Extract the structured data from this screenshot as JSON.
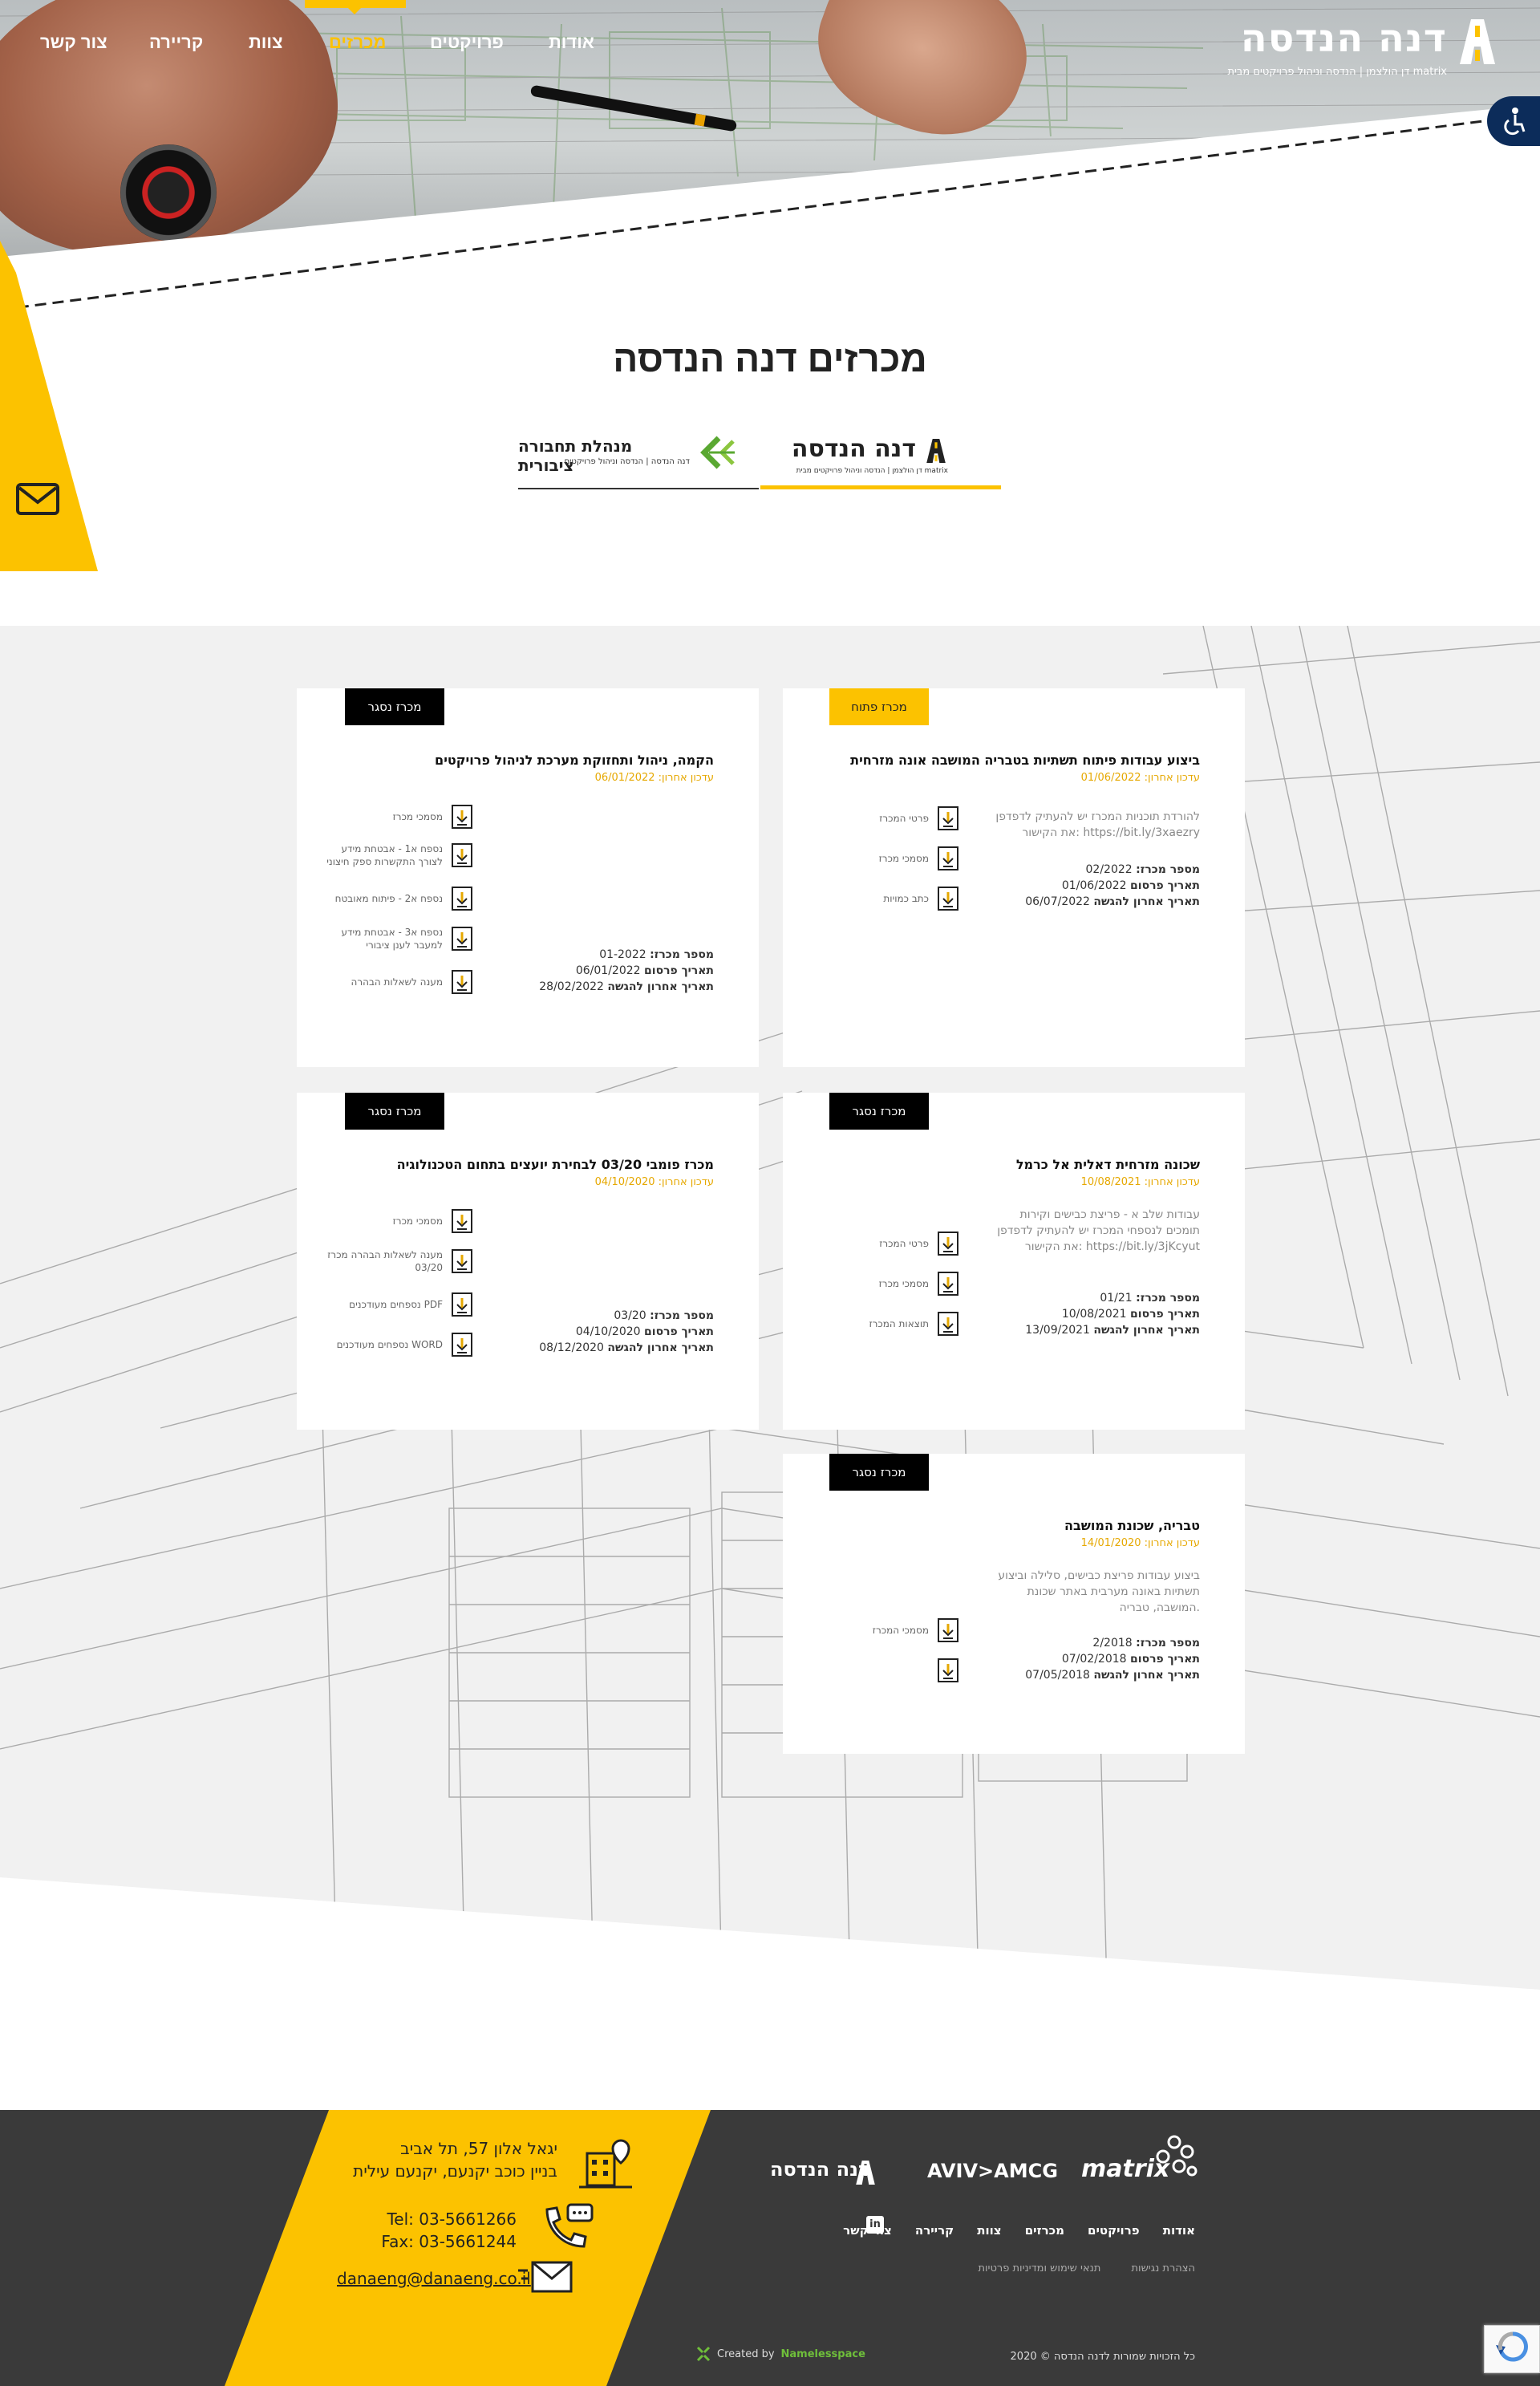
{
  "nav": {
    "items": [
      {
        "label": "אודות"
      },
      {
        "label": "פרויקטים"
      },
      {
        "label": "מכרזים",
        "active": true
      },
      {
        "label": "צוות"
      },
      {
        "label": "קריירה"
      },
      {
        "label": "צור קשר"
      }
    ]
  },
  "logo": {
    "title": "דנה הנדסה",
    "subtitle": "דן הולצמן | הנדסה וניהול פרויקטים מבית matrix"
  },
  "page": {
    "title": "מכרזים דנה הנדסה"
  },
  "tabs": [
    {
      "title": "דנה הנדסה",
      "subtitle": "דן הולצמן | הנדסה וניהול פרויקטים מבית matrix",
      "active": true
    },
    {
      "title": "מנהלת תחבורה ציבורית",
      "subtitle": "דנה הנדסה | הנדסה וניהול פרויקטים",
      "active": false
    }
  ],
  "cards": [
    {
      "status": "מכרז פתוח",
      "title": "ביצוע עבודות פיתוח תשתיות בטבריה המושבה אונה מזרחית",
      "updated": "עדכון אחרון: 01/06/2022",
      "description": "להורדת תוכניות המכרז יש להעתיק לדפדפן את הקישור: https://bit.ly/3xaezry",
      "tender_no_label": "מספר מכרז:",
      "tender_no": "02/2022",
      "publish_label": "תאריך פרסום",
      "publish": "01/06/2022",
      "deadline_label": "תאריך אחרון להגשה",
      "deadline": "06/07/2022",
      "downloads": [
        "פרטי המכרז",
        "מסמכי מכרז",
        "כתב כמויות"
      ]
    },
    {
      "status": "מכרז נסגר",
      "title": "הקמה, ניהול ותחזוקת מערכת לניהול פרויקטים",
      "updated": "עדכון אחרון: 06/01/2022",
      "description": "",
      "tender_no_label": "מספר מכרז:",
      "tender_no": "01-2022",
      "publish_label": "תאריך פרסום",
      "publish": "06/01/2022",
      "deadline_label": "תאריך אחרון להגשה",
      "deadline": "28/02/2022",
      "downloads": [
        "מסמכי מכרז",
        "נספח א1 - אבטחת מידע לצורך התקשרות ספק חיצוני",
        "נספח א2 - פיתוח מאובטח",
        "נספח א3 - אבטחת מידע למעבר לענן ציבורי",
        "מענה לשאלות הבהרה"
      ]
    },
    {
      "status": "מכרז נסגר",
      "title": "שכונה מזרחית דאלית אל כרמל",
      "updated": "עדכון אחרון: 10/08/2021",
      "description": "עבודות שלב א - פריצת כבישים וקירות תומכים לנספחי המכרז יש להעתיק לדפדפן את הקישור: https://bit.ly/3jKcyut",
      "tender_no_label": "מספר מכרז:",
      "tender_no": "01/21",
      "publish_label": "תאריך פרסום",
      "publish": "10/08/2021",
      "deadline_label": "תאריך אחרון להגשה",
      "deadline": "13/09/2021",
      "downloads": [
        "פרטי המכרז",
        "מסמכי מכרז",
        "תוצאות המכרז"
      ]
    },
    {
      "status": "מכרז נסגר",
      "title": "מכרז פומבי 03/20 לבחירת יועצים בתחום הטכנולוגיה",
      "updated": "עדכון אחרון: 04/10/2020",
      "description": "",
      "tender_no_label": "מספר מכרז:",
      "tender_no": "03/20",
      "publish_label": "תאריך פרסום",
      "publish": "04/10/2020",
      "deadline_label": "תאריך אחרון להגשה",
      "deadline": "08/12/2020",
      "downloads": [
        "מסמכי מכרז",
        "מענה לשאלות הבהרה מכרז 03/20",
        "נספחים מעודכנים PDF",
        "נספחים מעודכנים WORD"
      ]
    },
    {
      "status": "מכרז נסגר",
      "title": "טבריה, שכונת המושבה",
      "updated": "עדכון אחרון: 14/01/2020",
      "description": "ביצוע עבודות פריצת כבישים, סלילה וביצוע תשתיות באונה מערבית באתר שכונת המושבה, טבריה.",
      "tender_no_label": "מספר מכרז:",
      "tender_no": "2/2018",
      "publish_label": "תאריך פרסום",
      "publish": "07/02/2018",
      "deadline_label": "תאריך אחרון להגשה",
      "deadline": "07/05/2018",
      "downloads": [
        "מסמכי המכרז",
        ""
      ]
    }
  ],
  "footer": {
    "address_line1": "יגאל אלון 57, תל אביב",
    "address_line2": "בניין כוכב יקנעם, יקנעם עילית",
    "tel": "Tel: 03-5661266",
    "fax": "Fax: 03-5661244",
    "email": "danaeng@danaeng.co.il",
    "logos": [
      "matrix",
      "AVIV>AMCG",
      "דנה הנדסה"
    ],
    "nav": [
      "אודות",
      "פרויקטים",
      "מכרזים",
      "צוות",
      "קריירה",
      "צור קשר"
    ],
    "linkedin": "in",
    "links": [
      "תנאי שימוש ומדיניות פרטיות",
      "הצהרת נגישות"
    ],
    "copyright": "2020 © כל הזכויות שמורות לדנה הנדסה",
    "created_by_label": "Created by",
    "created_by": "Namelesspace"
  },
  "colors": {
    "accent": "#fcc200",
    "dark": "#3a3a3a",
    "access": "#0c2c5a"
  },
  "icons": [
    "accessibility-icon",
    "mail-icon",
    "download-icon",
    "location-icon",
    "phone-icon",
    "envelope-icon",
    "linkedin-icon"
  ]
}
